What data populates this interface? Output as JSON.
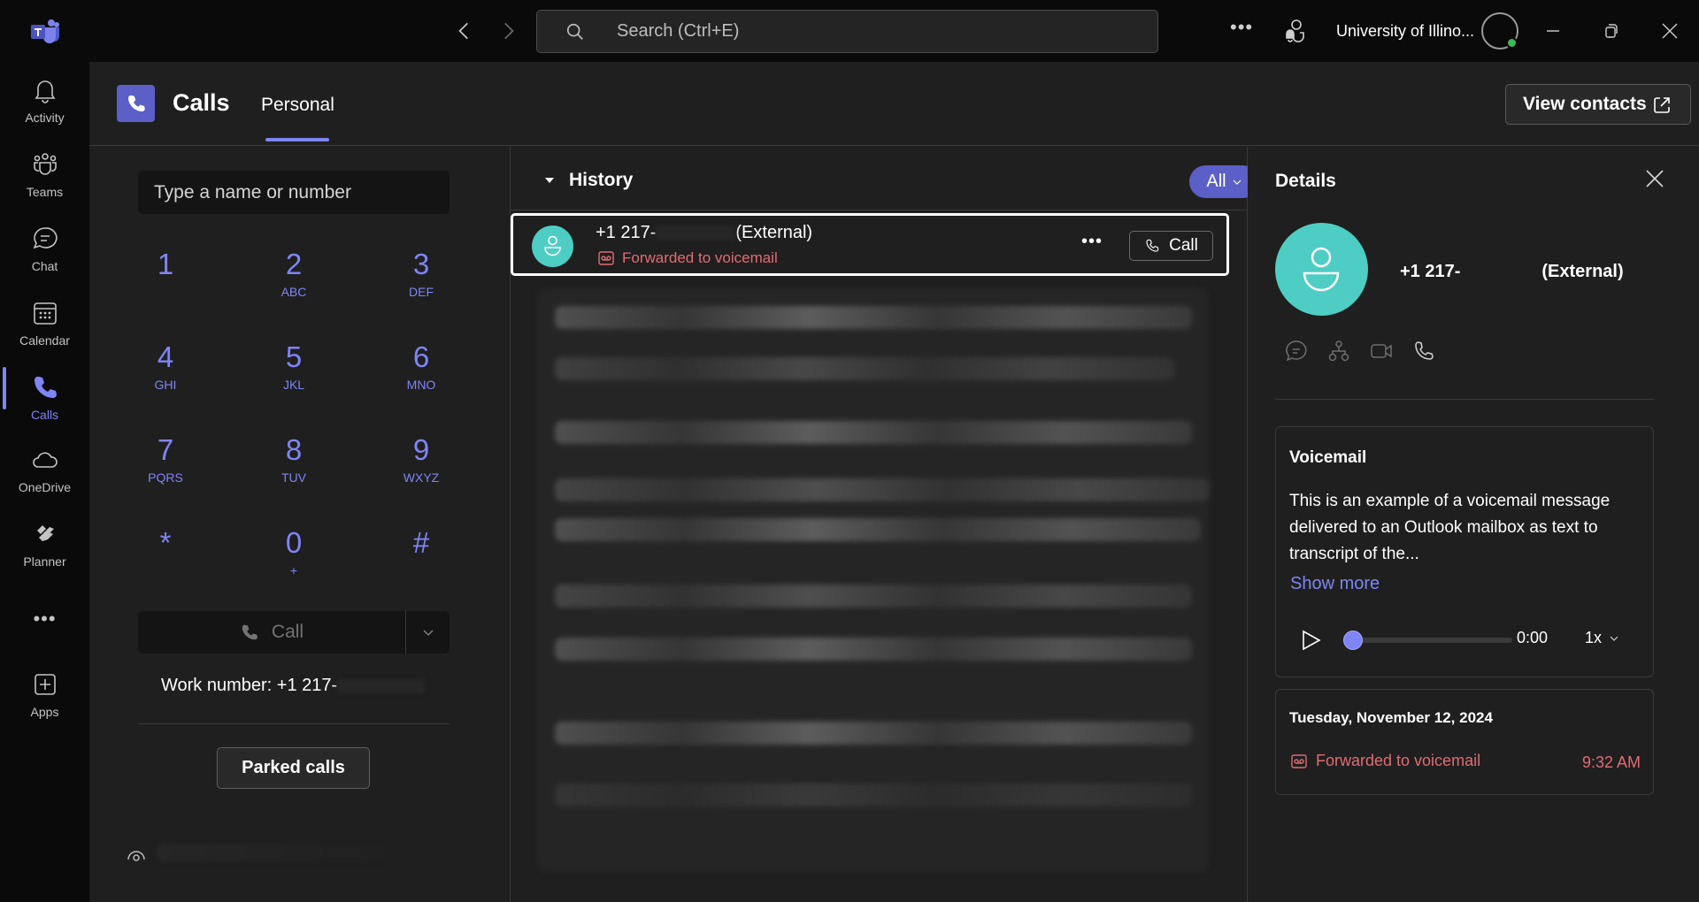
{
  "topbar": {
    "search_placeholder": "Search (Ctrl+E)",
    "org_name": "University of Illino...",
    "more_label": "•••"
  },
  "rail": {
    "items": [
      {
        "label": "Activity",
        "icon": "bell-icon"
      },
      {
        "label": "Teams",
        "icon": "teams-icon"
      },
      {
        "label": "Chat",
        "icon": "chat-icon"
      },
      {
        "label": "Calendar",
        "icon": "calendar-icon"
      },
      {
        "label": "Calls",
        "icon": "phone-icon",
        "active": true
      },
      {
        "label": "OneDrive",
        "icon": "cloud-icon"
      },
      {
        "label": "Planner",
        "icon": "planner-icon"
      },
      {
        "label": "Apps",
        "icon": "add-app-icon"
      }
    ],
    "more_label": "•••"
  },
  "header": {
    "app_title": "Calls",
    "tab": "Personal",
    "view_contacts_label": "View contacts"
  },
  "dialpad": {
    "input_placeholder": "Type a name or number",
    "keys": [
      {
        "digit": "1",
        "letters": ""
      },
      {
        "digit": "2",
        "letters": "ABC"
      },
      {
        "digit": "3",
        "letters": "DEF"
      },
      {
        "digit": "4",
        "letters": "GHI"
      },
      {
        "digit": "5",
        "letters": "JKL"
      },
      {
        "digit": "6",
        "letters": "MNO"
      },
      {
        "digit": "7",
        "letters": "PQRS"
      },
      {
        "digit": "8",
        "letters": "TUV"
      },
      {
        "digit": "9",
        "letters": "WXYZ"
      },
      {
        "digit": "*",
        "letters": ""
      },
      {
        "digit": "0",
        "letters": "+"
      },
      {
        "digit": "#",
        "letters": ""
      }
    ],
    "call_label": "Call",
    "work_number": "Work number: +1 217-",
    "parked_calls_label": "Parked calls"
  },
  "history": {
    "title": "History",
    "filter_label": "All",
    "items": [
      {
        "number_prefix": "+1 217-",
        "number_suffix": "(External)",
        "status": "Forwarded to voicemail",
        "more_label": "•••",
        "call_label": "Call"
      }
    ]
  },
  "details": {
    "title": "Details",
    "number_prefix": "+1 217-",
    "number_suffix": "(External)",
    "voicemail": {
      "title": "Voicemail",
      "transcript": "This is an example of a voicemail message delivered to an Outlook mailbox as text to transcript of the...",
      "show_more_label": "Show more",
      "time": "0:00",
      "speed": "1x",
      "progress": 0
    },
    "log": {
      "date": "Tuesday, November 12, 2024",
      "status": "Forwarded to voicemail",
      "time": "9:32 AM"
    }
  },
  "colors": {
    "accent": "#7f85f5",
    "brand": "#5b5fc7",
    "avatar": "#4ecdc4",
    "missed": "#e06c75"
  }
}
